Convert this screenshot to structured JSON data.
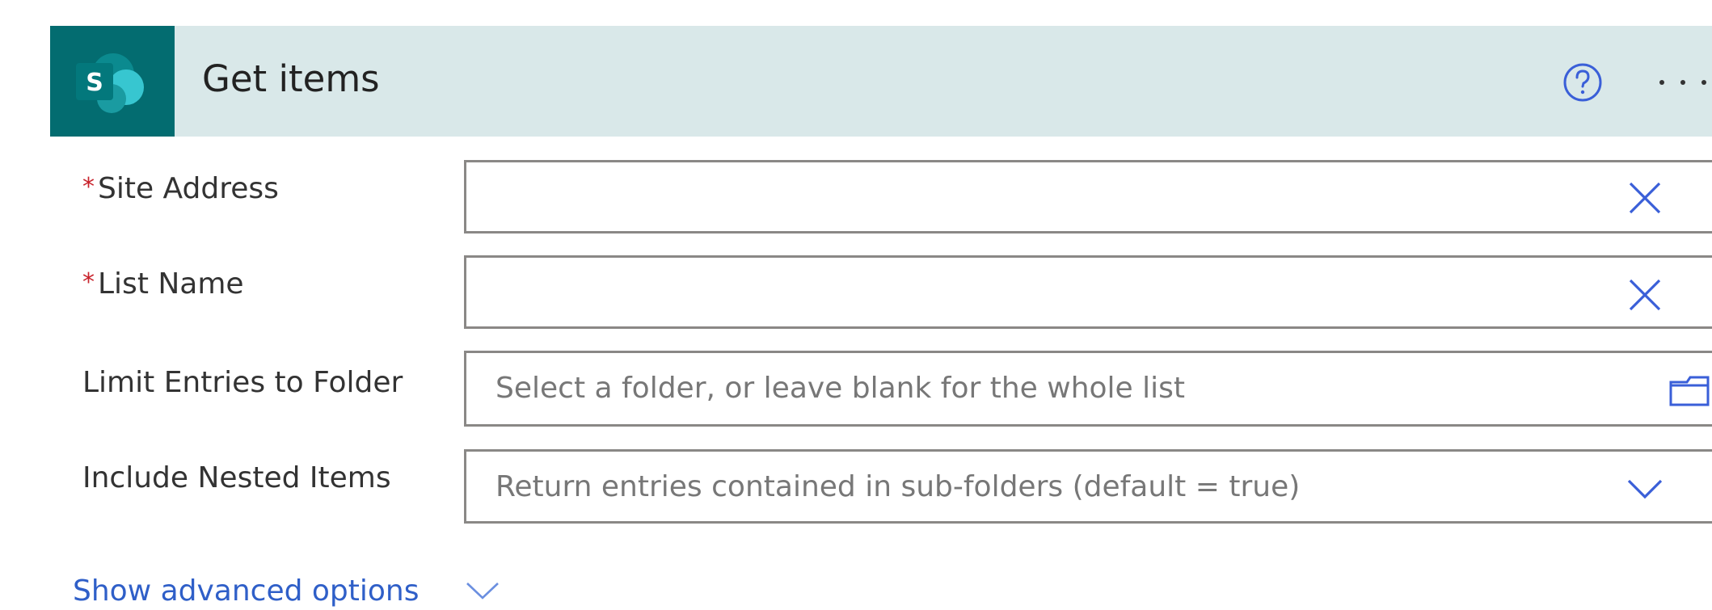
{
  "action": {
    "title": "Get items",
    "icon": "sharepoint-logo-icon",
    "logo_letter": "S",
    "help_icon": "help-icon",
    "more_icon": "more-options-icon"
  },
  "fields": {
    "site_address": {
      "label": "Site Address",
      "required": "*",
      "value": "",
      "icon": "clear-icon"
    },
    "list_name": {
      "label": "List Name",
      "required": "*",
      "value": "",
      "icon": "clear-icon"
    },
    "folder": {
      "label": "Limit Entries to Folder",
      "placeholder": "Select a folder, or leave blank for the whole list",
      "icon": "folder-icon"
    },
    "nested": {
      "label": "Include Nested Items",
      "placeholder": "Return entries contained in sub-folders (default = true)",
      "icon": "chevron-down-icon"
    }
  },
  "advanced": {
    "label": "Show advanced options",
    "icon": "chevron-down-icon"
  },
  "colors": {
    "header_bg": "#d9e8e9",
    "logo_bg": "#036c70",
    "required": "#c8222b",
    "link": "#2f5fc8",
    "icon_blue": "#3a5fd8"
  }
}
